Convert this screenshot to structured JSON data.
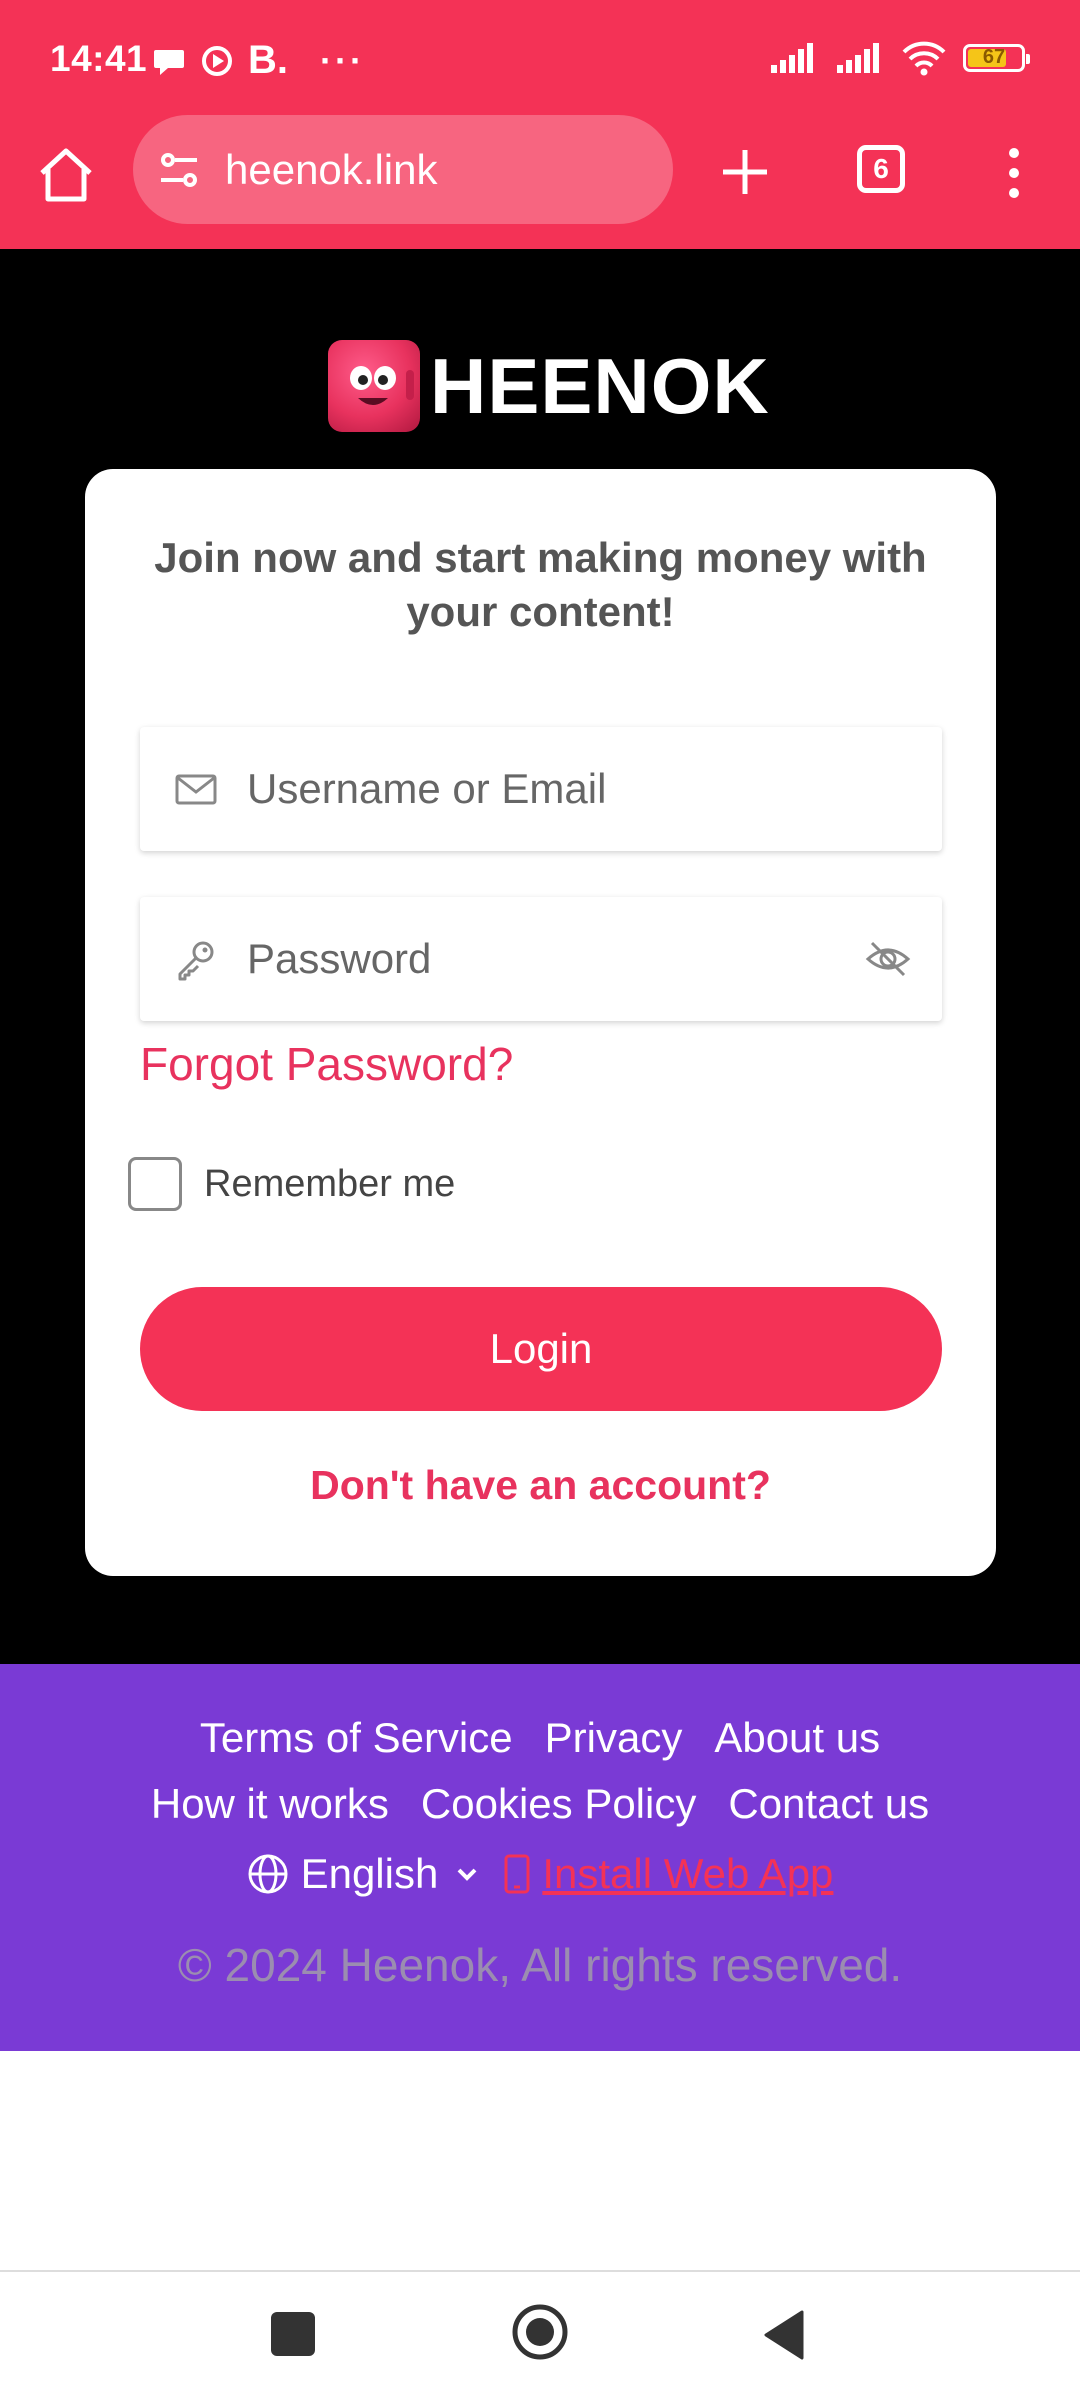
{
  "status_bar": {
    "time": "14:41",
    "b_label": "B.",
    "dots": "···",
    "battery": "67"
  },
  "browser": {
    "url": "heenok.link",
    "tab_count": "6"
  },
  "logo": {
    "text": "HEENOK"
  },
  "login": {
    "tagline": "Join now and start making money with your content!",
    "username_placeholder": "Username or Email",
    "password_placeholder": "Password",
    "forgot_password": "Forgot Password?",
    "remember_me": "Remember me",
    "login_button": "Login",
    "signup_link": "Don't have an account?"
  },
  "footer": {
    "links_row1": [
      "Terms of Service",
      "Privacy",
      "About us"
    ],
    "links_row2": [
      "How it works",
      "Cookies Policy",
      "Contact us"
    ],
    "language": "English",
    "install_app": "Install Web App",
    "copyright": "© 2024 Heenok, All rights reserved."
  },
  "colors": {
    "accent": "#f43256",
    "footer_bg": "#7a3ad5",
    "page_bg": "#000000"
  }
}
